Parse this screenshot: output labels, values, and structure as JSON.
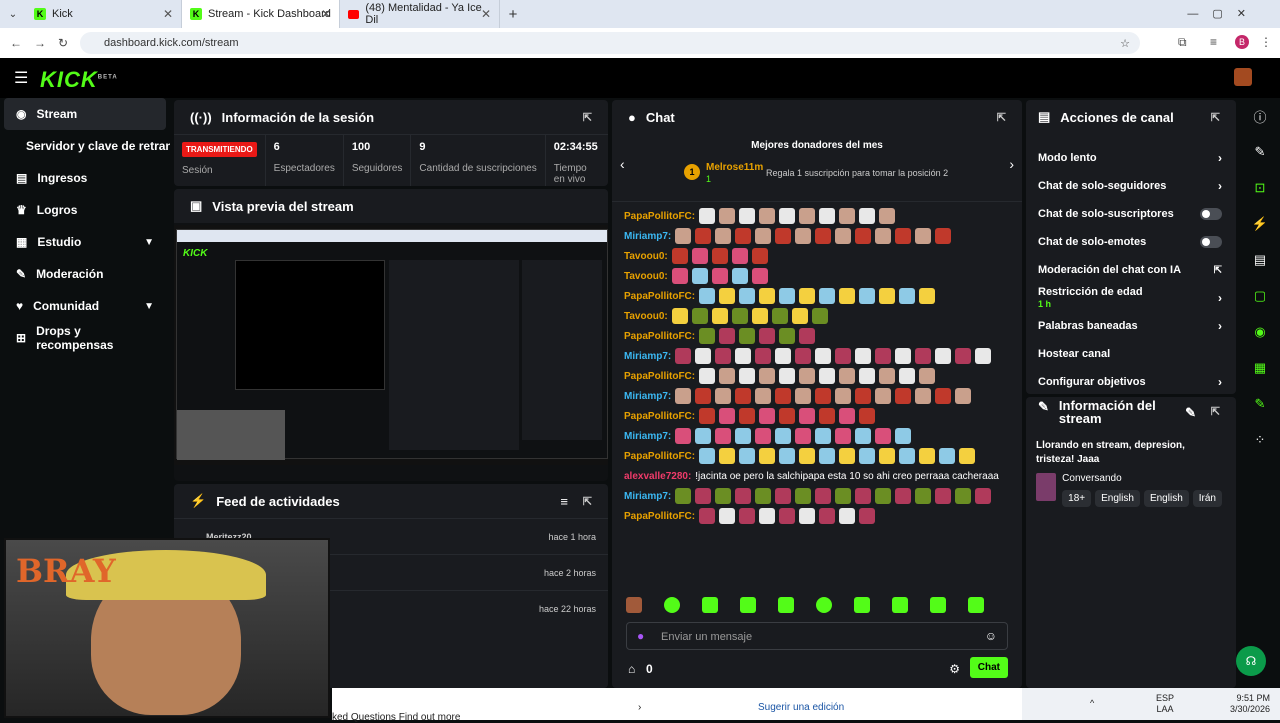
{
  "browser": {
    "tabs": [
      {
        "title": "Kick"
      },
      {
        "title": "Stream - Kick Dashboard"
      },
      {
        "title": "(48) Mentalidad - Ya Ice Dil"
      }
    ],
    "url": "dashboard.kick.com/stream",
    "profile_initial": "B"
  },
  "app": {
    "logo": "KICK",
    "logo_beta": "BETA"
  },
  "sidebar": {
    "items": [
      {
        "label": "Stream",
        "icon": "stream-icon"
      },
      {
        "label": "Servidor y clave de retransn"
      },
      {
        "label": "Ingresos",
        "icon": "revenue-icon"
      },
      {
        "label": "Logros",
        "icon": "trophy-icon"
      },
      {
        "label": "Estudio",
        "icon": "studio-icon"
      },
      {
        "label": "Moderación",
        "icon": "wrench-icon"
      },
      {
        "label": "Comunidad",
        "icon": "community-icon"
      },
      {
        "label": "Drops y recompensas",
        "icon": "drops-icon"
      }
    ]
  },
  "session": {
    "title": "Información de la sesión",
    "status": "TRANSMITIENDO",
    "status_label": "Sesión",
    "stats": [
      {
        "value": "6",
        "label": "Espectadores"
      },
      {
        "value": "100",
        "label": "Seguidores"
      },
      {
        "value": "9",
        "label": "Cantidad de suscripciones"
      },
      {
        "value": "02:34:55",
        "label": "Tiempo en vivo"
      }
    ]
  },
  "preview": {
    "title": "Vista previa del stream"
  },
  "feed": {
    "title": "Feed de actividades",
    "rows": [
      {
        "name": "Meritezz20",
        "time": "hace 1 hora"
      },
      {
        "name": "",
        "time": "hace 2 horas"
      },
      {
        "name": "",
        "time": "hace 22 horas"
      }
    ]
  },
  "webcam": {
    "overlay_text": "BRAY"
  },
  "chat": {
    "title": "Chat",
    "top_donors_title": "Mejores donadores del mes",
    "top_donor": {
      "rank": "1",
      "name": "Melrose11m",
      "count": "1"
    },
    "gift_prompt": "Regala 1 suscripción para tomar la posición 2",
    "messages": [
      {
        "user": "PapaPollitoFC",
        "color": "#e7a100",
        "emotes": 10
      },
      {
        "user": "Miriamp7",
        "color": "#3bb8f3",
        "emotes": 14
      },
      {
        "user": "Tavoou0",
        "color": "#e7a100",
        "emotes": 5
      },
      {
        "user": "Tavoou0",
        "color": "#e7a100",
        "emotes": 5
      },
      {
        "user": "PapaPollitoFC",
        "color": "#e7a100",
        "emotes": 12
      },
      {
        "user": "Tavoou0",
        "color": "#e7a100",
        "emotes": 8
      },
      {
        "user": "PapaPollitoFC",
        "color": "#e7a100",
        "emotes": 6
      },
      {
        "user": "Miriamp7",
        "color": "#3bb8f3",
        "emotes": 16
      },
      {
        "user": "PapaPollitoFC",
        "color": "#e7a100",
        "emotes": 12
      },
      {
        "user": "Miriamp7",
        "color": "#3bb8f3",
        "emotes": 15
      },
      {
        "user": "PapaPollitoFC",
        "color": "#e7a100",
        "emotes": 9
      },
      {
        "user": "Miriamp7",
        "color": "#3bb8f3",
        "emotes": 12
      },
      {
        "user": "PapaPollitoFC",
        "color": "#e7a100",
        "emotes": 14
      },
      {
        "user": "alexvalle7280",
        "color": "#f03b6a",
        "text": "!jacinta oe pero la salchipapa esta 10 so ahi creo perraaa cacheraaa"
      },
      {
        "user": "Miriamp7",
        "color": "#3bb8f3",
        "emotes": 16
      },
      {
        "user": "PapaPollitoFC",
        "color": "#e7a100",
        "emotes": 9
      }
    ],
    "input_placeholder": "Enviar un mensaje",
    "points": "0",
    "send_label": "Chat"
  },
  "actions": {
    "title": "Acciones de canal",
    "items": [
      {
        "label": "Modo lento",
        "kind": "chevron"
      },
      {
        "label": "Chat de solo-seguidores",
        "kind": "chevron"
      },
      {
        "label": "Chat de solo-suscriptores",
        "kind": "toggle"
      },
      {
        "label": "Chat de solo-emotes",
        "kind": "toggle"
      },
      {
        "label": "Moderación del chat con IA",
        "kind": "external"
      },
      {
        "label": "Restricción de edad",
        "sub": "1 h",
        "kind": "chevron"
      },
      {
        "label": "Palabras baneadas",
        "kind": "chevron"
      },
      {
        "label": "Hostear canal",
        "kind": "none"
      },
      {
        "label": "Configurar objetivos",
        "kind": "chevron"
      }
    ]
  },
  "stream_info": {
    "title": "Información del stream",
    "stream_title": "Llorando en stream, depresion, tristeza! Jaaa",
    "category": "Conversando",
    "tags": [
      "18+",
      "English",
      "English",
      "Irán"
    ]
  },
  "bottom": {
    "faq": "ked Questions Find out more",
    "suggest": "Sugerir una edición"
  },
  "taskbar": {
    "lang1": "ESP",
    "lang2": "LAA",
    "time": "9:51 PM",
    "date": "3/30/2026"
  }
}
